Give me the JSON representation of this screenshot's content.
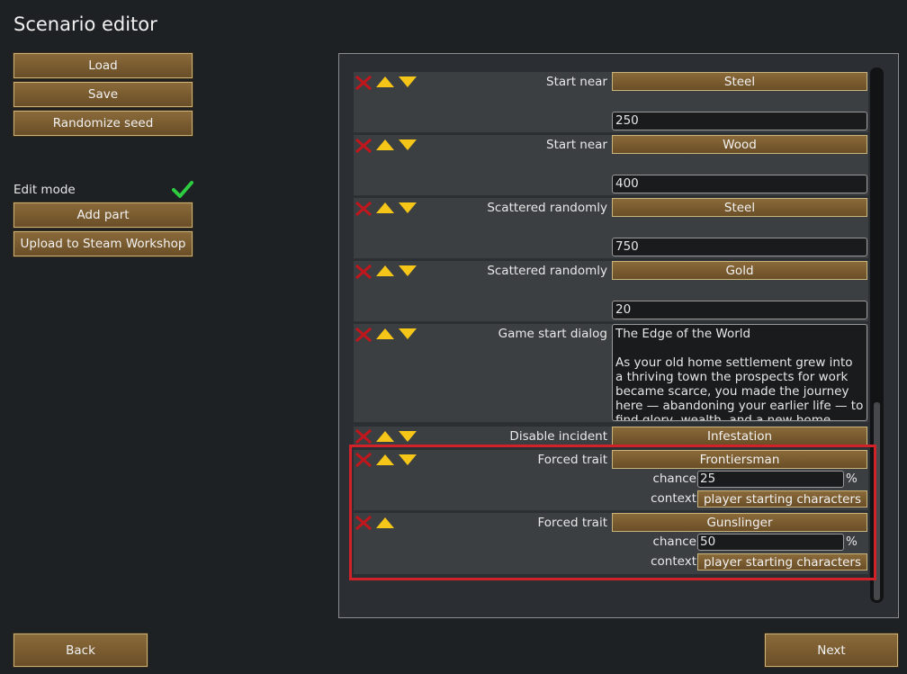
{
  "title": "Scenario editor",
  "left_menu": {
    "load": "Load",
    "save": "Save",
    "randomize": "Randomize seed",
    "edit_mode": "Edit mode",
    "add_part": "Add part",
    "upload": "Upload to Steam Workshop"
  },
  "parts": [
    {
      "label": "Start near",
      "button": "Steel",
      "value": "250"
    },
    {
      "label": "Start near",
      "button": "Wood",
      "value": "400"
    },
    {
      "label": "Scattered randomly",
      "button": "Steel",
      "value": "750"
    },
    {
      "label": "Scattered randomly",
      "button": "Gold",
      "value": "20"
    },
    {
      "label": "Game start dialog",
      "text": "The Edge of the World\n\nAs your old home settlement grew into a thriving town the prospects for work became scarce, you made the journey here — abandoning your earlier life — to find glory, wealth, and a new home."
    },
    {
      "label": "Disable incident",
      "button": "Infestation"
    },
    {
      "label": "Forced trait",
      "button": "Frontiersman",
      "chance_label": "chance",
      "chance": "25",
      "pct": "%",
      "context_label": "context",
      "context": "player starting characters"
    },
    {
      "label": "Forced trait",
      "button": "Gunslinger",
      "chance_label": "chance",
      "chance": "50",
      "pct": "%",
      "context_label": "context",
      "context": "player starting characters"
    }
  ],
  "bottom": {
    "back": "Back",
    "next": "Next"
  },
  "colors": {
    "highlight": "#d1222a",
    "button": "#7a5c30",
    "check": "#2ecc40"
  }
}
